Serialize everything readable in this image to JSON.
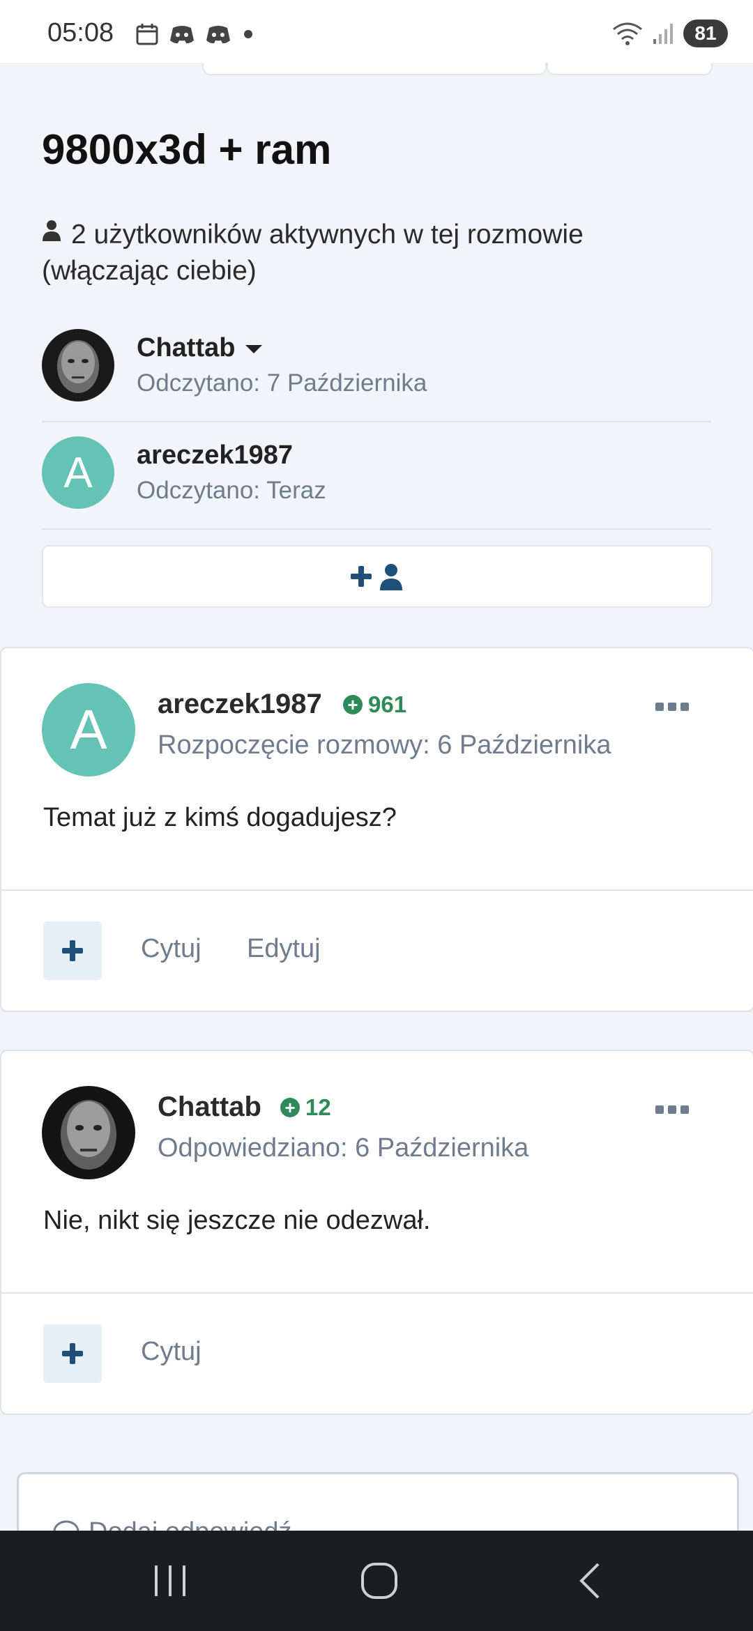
{
  "status_bar": {
    "time": "05:08",
    "battery": "81"
  },
  "conversation": {
    "title": "9800x3d + ram",
    "active_users": "2 użytkowników aktywnych w tej rozmowie (włączając ciebie)",
    "participants": [
      {
        "name": "Chattab",
        "read": "Odczytano: 7 Października"
      },
      {
        "name": "areczek1987",
        "read": "Odczytano: Teraz",
        "avatar_letter": "A"
      }
    ]
  },
  "messages": [
    {
      "author": "areczek1987",
      "avatar_letter": "A",
      "reputation": "961",
      "meta": "Rozpoczęcie rozmowy: 6 Października",
      "text": "Temat już z kimś dogadujesz?",
      "actions": [
        "Cytuj",
        "Edytuj"
      ]
    },
    {
      "author": "Chattab",
      "reputation": "12",
      "meta": "Odpowiedziano: 6 Października",
      "text": "Nie, nikt się jeszcze nie odezwał.",
      "actions": [
        "Cytuj"
      ]
    }
  ],
  "reply": {
    "placeholder": "Dodaj odpowiedź"
  },
  "colors": {
    "accent": "#1f4e79",
    "reputation": "#2f8a5a",
    "avatar_letter_bg": "#64c3b5",
    "page_bg": "#f1f5f9"
  }
}
